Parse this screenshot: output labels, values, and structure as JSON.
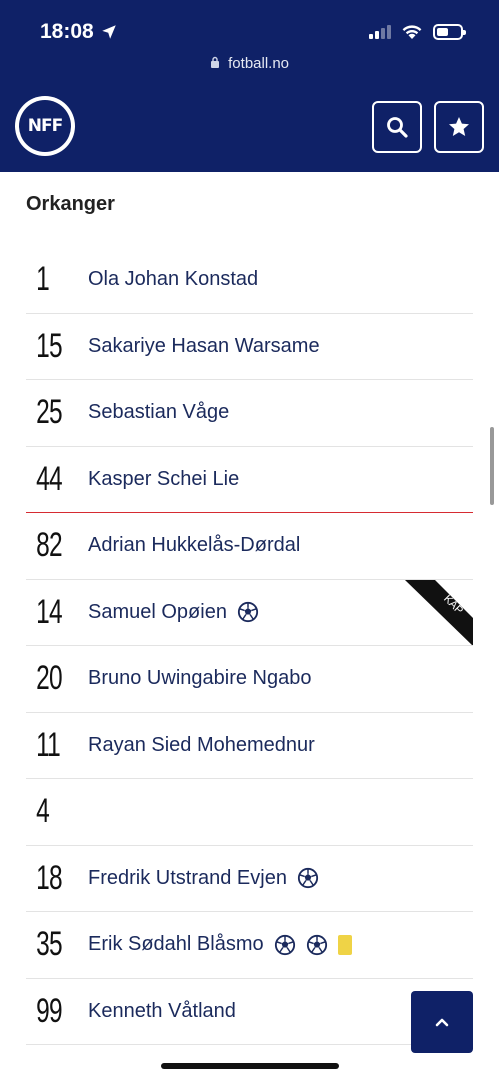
{
  "status_bar": {
    "time": "18:08"
  },
  "browser": {
    "url": "fotball.no"
  },
  "header": {
    "logo_text": "NFF"
  },
  "team": {
    "name": "Orkanger"
  },
  "players": [
    {
      "number": "1",
      "name": "Ola Johan Konstad",
      "goals": 0,
      "yellow_cards": 0
    },
    {
      "number": "15",
      "name": "Sakariye Hasan Warsame",
      "goals": 0,
      "yellow_cards": 0
    },
    {
      "number": "25",
      "name": "Sebastian Våge",
      "goals": 0,
      "yellow_cards": 0
    },
    {
      "number": "44",
      "name": "Kasper Schei Lie",
      "goals": 0,
      "yellow_cards": 0
    },
    {
      "number": "82",
      "name": "Adrian Hukkelås-Dørdal",
      "goals": 0,
      "yellow_cards": 0
    },
    {
      "number": "14",
      "name": "Samuel Opøien",
      "goals": 1,
      "yellow_cards": 0,
      "badge": "KAP"
    },
    {
      "number": "20",
      "name": "Bruno Uwingabire Ngabo",
      "goals": 0,
      "yellow_cards": 0
    },
    {
      "number": "11",
      "name": "Rayan Sied Mohemednur",
      "goals": 0,
      "yellow_cards": 0
    },
    {
      "number": "4",
      "name": "",
      "goals": 0,
      "yellow_cards": 0
    },
    {
      "number": "18",
      "name": "Fredrik Utstrand Evjen",
      "goals": 1,
      "yellow_cards": 0
    },
    {
      "number": "35",
      "name": "Erik Sødahl Blåsmo",
      "goals": 2,
      "yellow_cards": 1
    },
    {
      "number": "99",
      "name": "Kenneth Våtland",
      "goals": 0,
      "yellow_cards": 0
    }
  ],
  "icons": {
    "location": "location-arrow-icon",
    "search": "search-icon",
    "favorite": "star-icon",
    "goal": "football-icon",
    "scroll_top": "chevron-up-icon"
  },
  "colors": {
    "brand_navy": "#0f2167",
    "divider_red": "#d62b32",
    "yellow_card": "#efd346"
  }
}
